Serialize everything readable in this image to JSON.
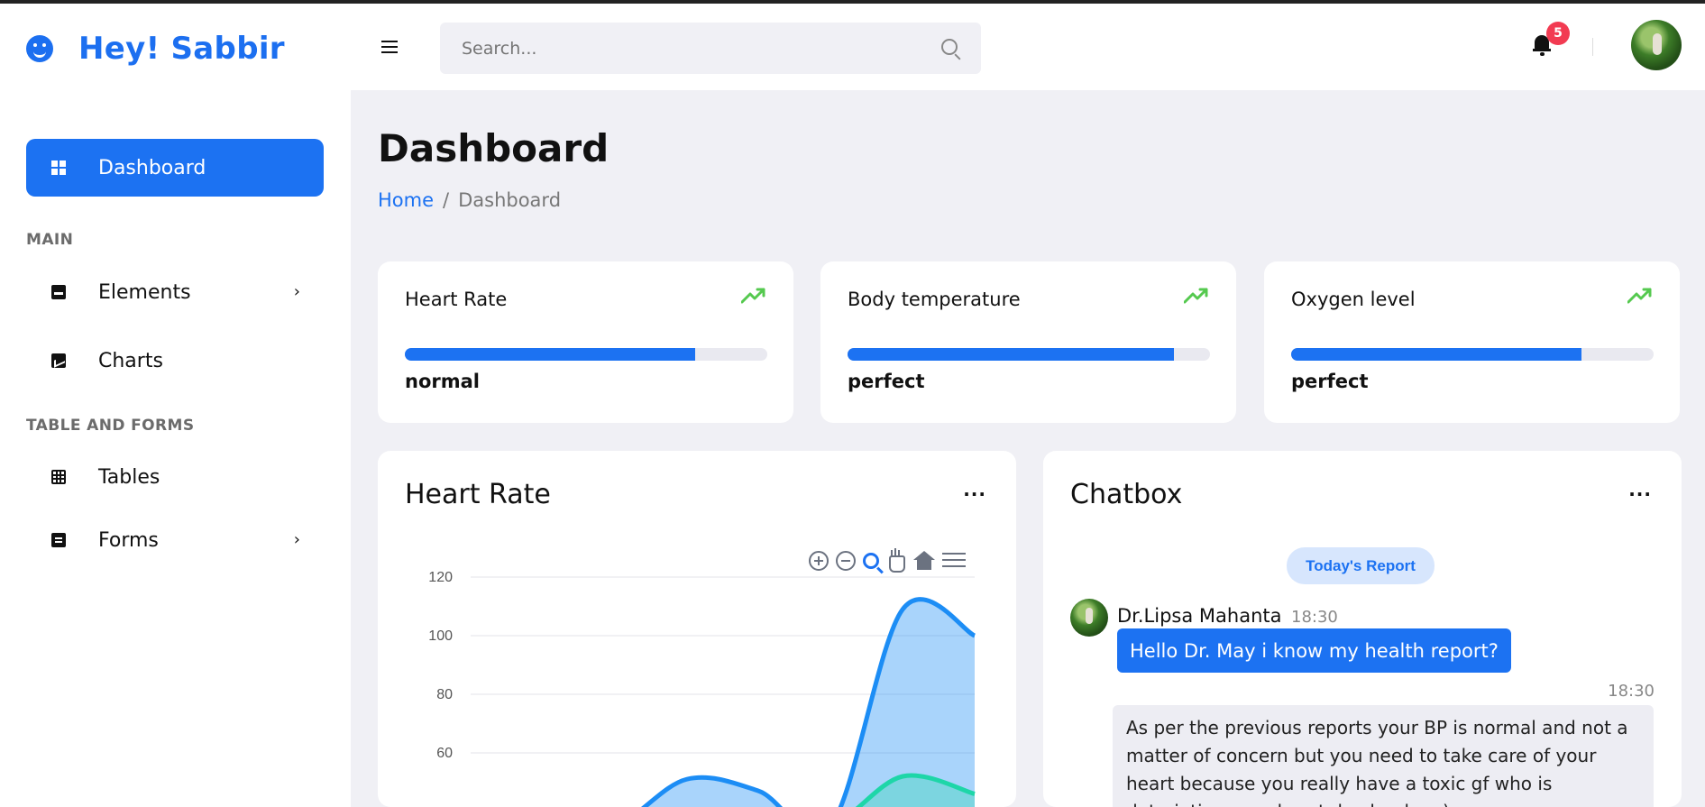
{
  "app": {
    "brand": "Hey! Sabbir"
  },
  "header": {
    "search_placeholder": "Search...",
    "notification_count": "5"
  },
  "sidebar": {
    "active": {
      "label": "Dashboard"
    },
    "sections": [
      {
        "title": "MAIN",
        "items": [
          {
            "label": "Elements",
            "chevron": "›"
          },
          {
            "label": "Charts"
          }
        ]
      },
      {
        "title": "TABLE AND FORMS",
        "items": [
          {
            "label": "Tables"
          },
          {
            "label": "Forms",
            "chevron": "›"
          }
        ]
      }
    ]
  },
  "main": {
    "title": "Dashboard",
    "breadcrumb": {
      "home": "Home",
      "separator": "/",
      "current": "Dashboard"
    },
    "stats": [
      {
        "label": "Heart Rate",
        "status": "normal",
        "progress": 0.8
      },
      {
        "label": "Body temperature",
        "status": "perfect",
        "progress": 0.9
      },
      {
        "label": "Oxygen level",
        "status": "perfect",
        "progress": 0.8
      }
    ],
    "heart_panel": {
      "title": "Heart Rate",
      "more": "···"
    },
    "chat_panel": {
      "title": "Chatbox",
      "more": "···",
      "report_button": "Today's Report",
      "message": {
        "sender": "Dr.Lipsa Mahanta",
        "time": "18:30",
        "text": "Hello Dr. May i know my health report?"
      },
      "reply": {
        "time": "18:30",
        "text": "As per the previous reports your BP is normal and not a matter of concern but you need to take care of your heart because you really have a toxic gf who is detoriating your heart day by day :)"
      }
    }
  },
  "chart_data": {
    "type": "area",
    "title": "Heart Rate",
    "xlabel": "",
    "ylabel": "",
    "yticks": [
      "60",
      "80",
      "100",
      "120"
    ],
    "ylim": [
      40,
      120
    ],
    "series": [
      {
        "values": [
          35,
          35,
          35,
          51,
          47,
          35,
          109,
          100
        ]
      },
      {
        "values": [
          35,
          35,
          35,
          35,
          35,
          35,
          52,
          46
        ]
      }
    ],
    "colors": [
      "#1c8df5",
      "#1ed6a8"
    ]
  }
}
